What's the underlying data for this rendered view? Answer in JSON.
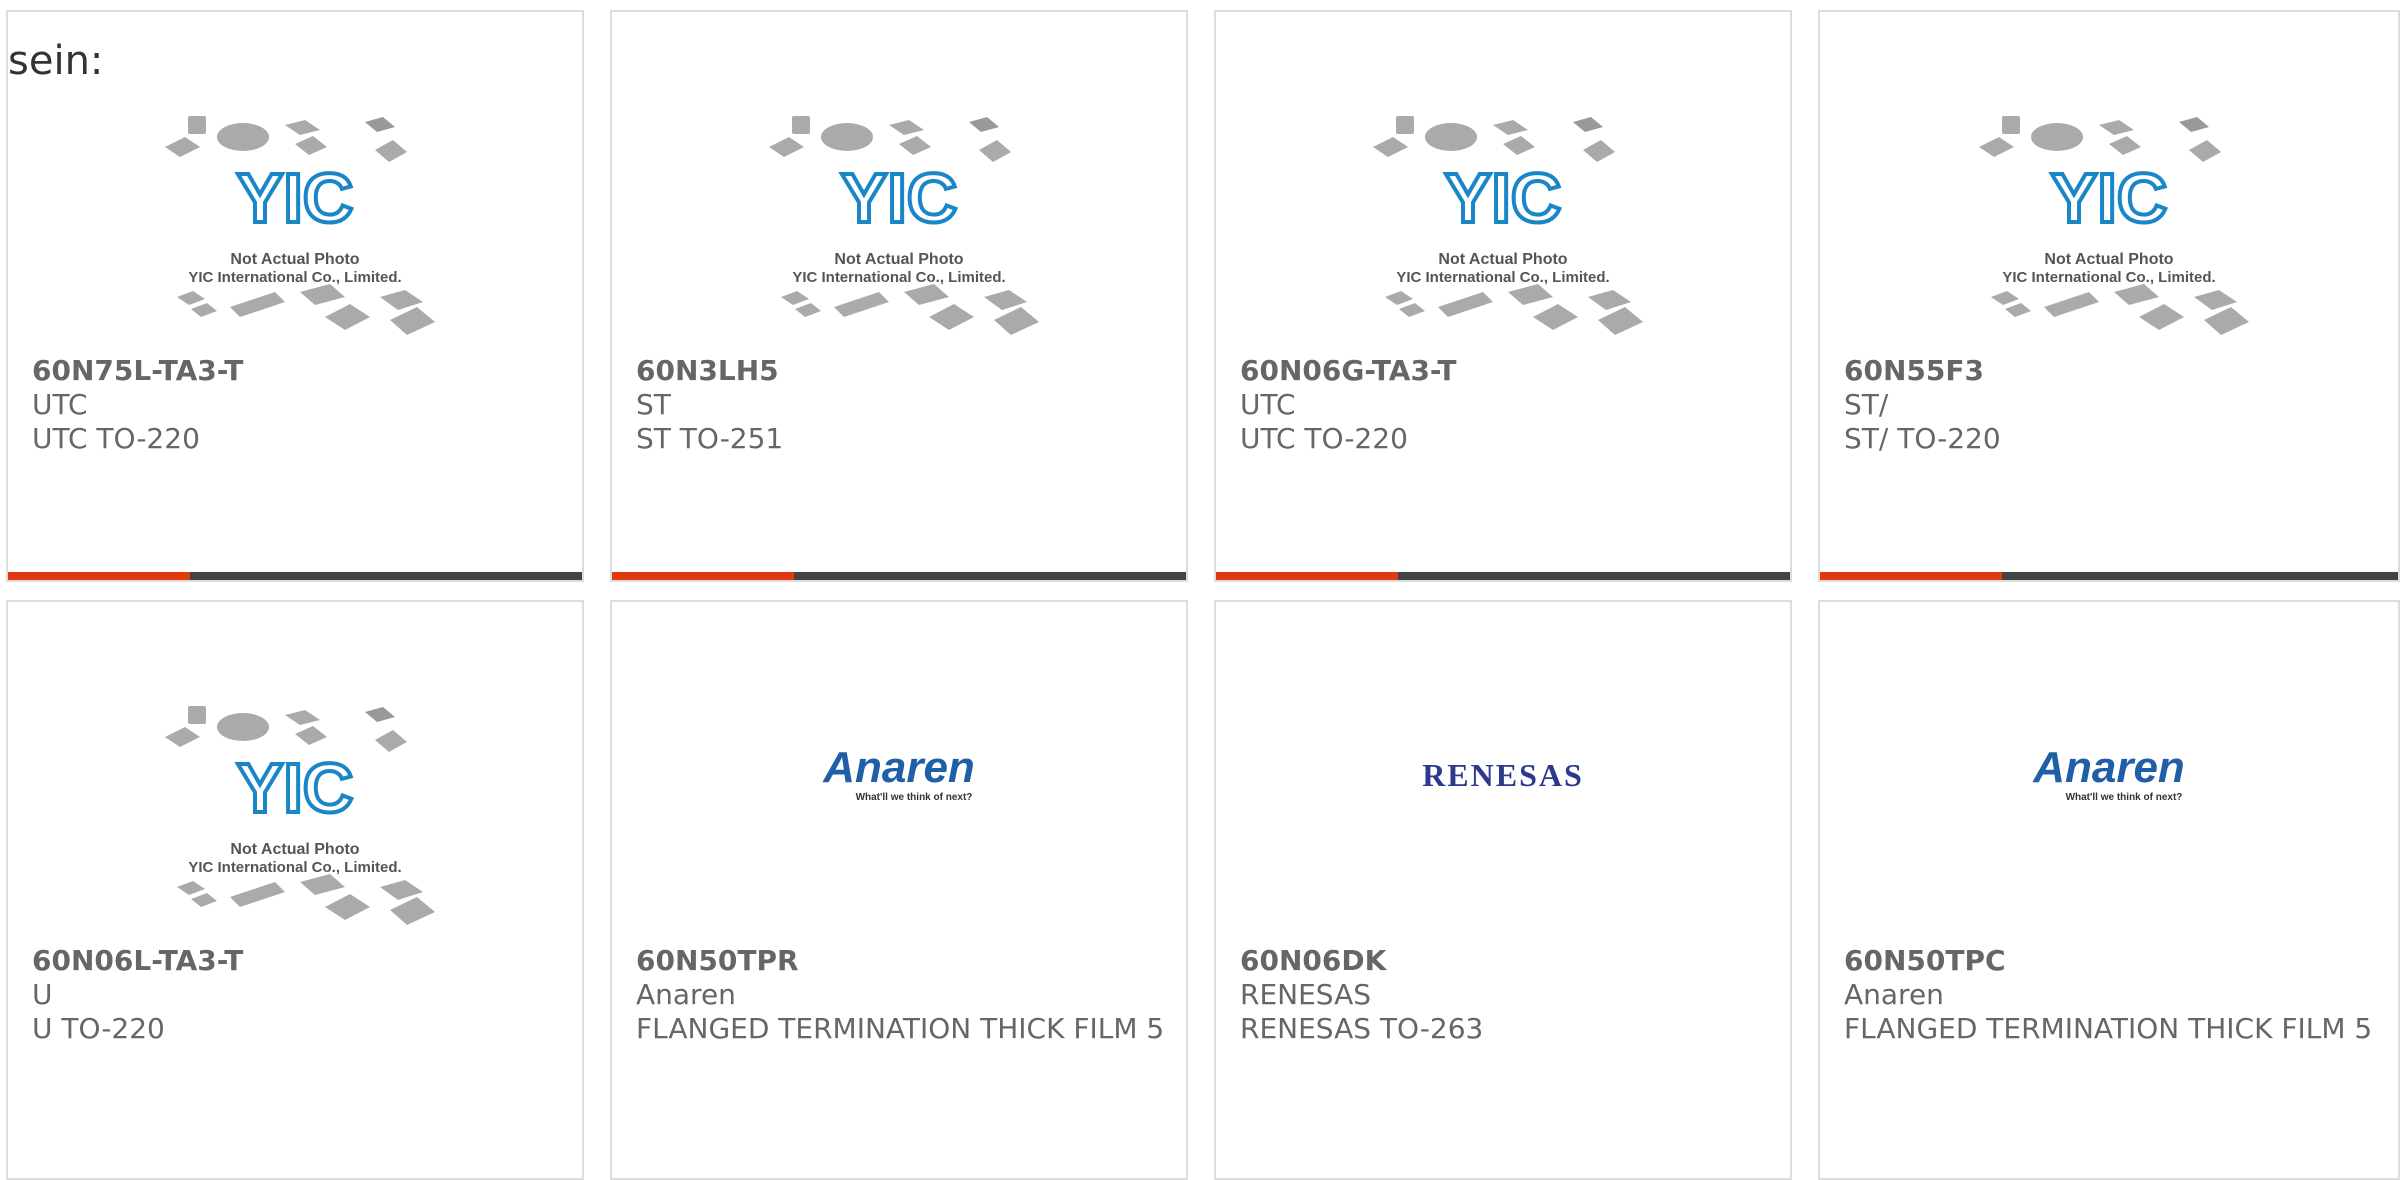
{
  "intro_text": "sein:",
  "placeholder": {
    "line1": "Not Actual Photo",
    "line2": "YIC International Co., Limited."
  },
  "logos": {
    "anaren": {
      "text": "Anaren",
      "tagline": "What'll we think of next?"
    },
    "renesas": {
      "text": "RENESAS"
    }
  },
  "colors": {
    "accent": "#e2380d",
    "bar": "#444444",
    "yic_blue": "#1a86c8",
    "anaren_blue": "#1f5fa8",
    "renesas_blue": "#2b3a8c"
  },
  "products": [
    {
      "part": "60N75L-TA3-T",
      "brand": "UTC",
      "desc": "UTC TO-220",
      "image": "yic-placeholder"
    },
    {
      "part": "60N3LH5",
      "brand": "ST",
      "desc": "ST TO-251",
      "image": "yic-placeholder"
    },
    {
      "part": "60N06G-TA3-T",
      "brand": "UTC",
      "desc": "UTC TO-220",
      "image": "yic-placeholder"
    },
    {
      "part": "60N55F3",
      "brand": "ST/",
      "desc": "ST/ TO-220",
      "image": "yic-placeholder"
    },
    {
      "part": "60N06L-TA3-T",
      "brand": "U",
      "desc": "U TO-220",
      "image": "yic-placeholder"
    },
    {
      "part": "60N50TPR",
      "brand": "Anaren",
      "desc": "FLANGED TERMINATION THICK FILM 5",
      "image": "anaren-logo"
    },
    {
      "part": "60N06DK",
      "brand": "RENESAS",
      "desc": "RENESAS TO-263",
      "image": "renesas-logo"
    },
    {
      "part": "60N50TPC",
      "brand": "Anaren",
      "desc": "FLANGED TERMINATION THICK FILM 5",
      "image": "anaren-logo"
    }
  ]
}
